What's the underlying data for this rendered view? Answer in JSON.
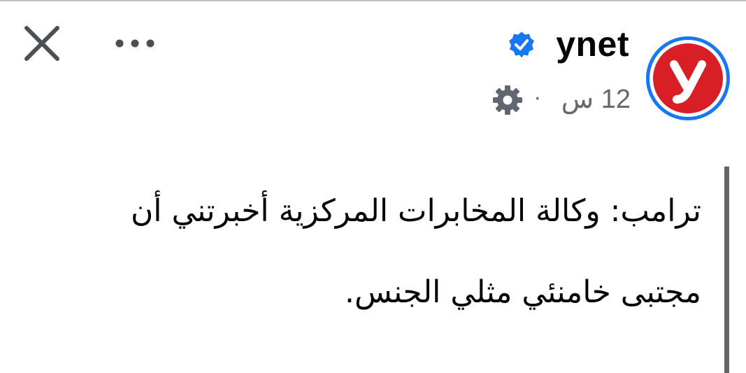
{
  "header": {
    "page_name": "ynet",
    "time": "12 س",
    "separator": "·",
    "close_icon": "close-icon",
    "more_icon": "more-horizontal-icon",
    "verified_icon": "verified-badge-icon",
    "audience_icon": "gear-icon",
    "avatar_logo_letter": "y",
    "colors": {
      "avatar_ring": "#1877f2",
      "logo_red": "#d81f26",
      "verified_blue": "#1877f2",
      "meta_gray": "#65676b"
    }
  },
  "post": {
    "text": "ترامب: وكالة المخابرات المركزية أخبرتني أن مجتبى خامنئي مثلي الجنس."
  }
}
